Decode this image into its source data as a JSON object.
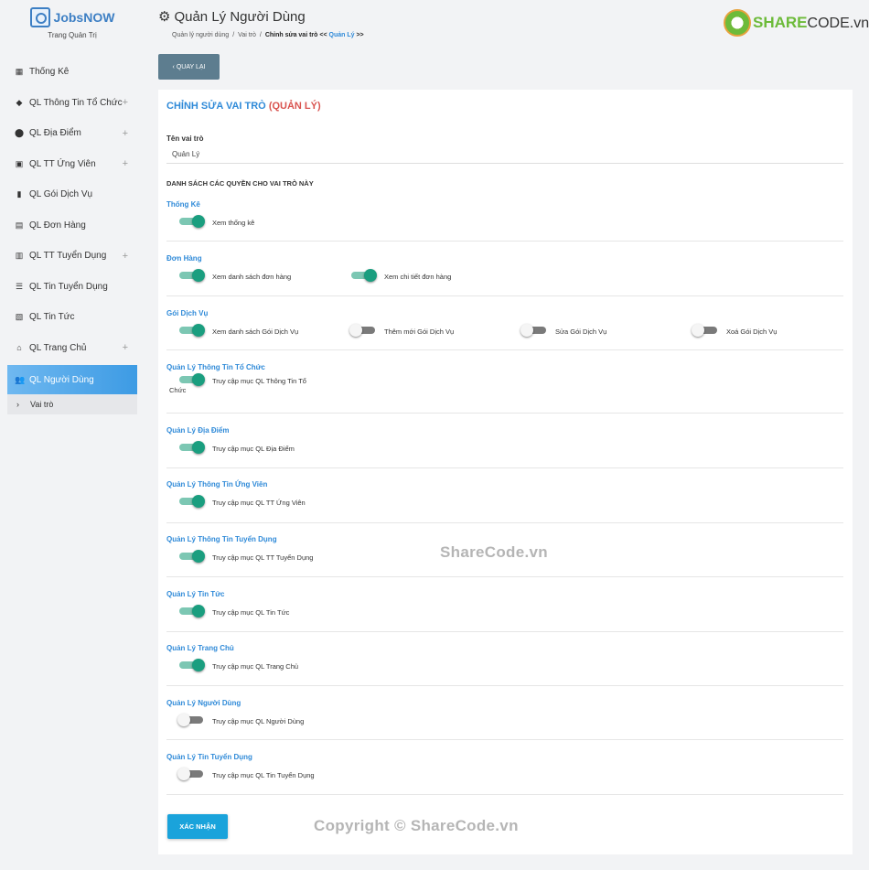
{
  "brand": {
    "name": "JobsNOW",
    "subtitle": "Trang Quản Trị"
  },
  "sidebar": {
    "items": [
      {
        "label": "Thống Kê",
        "icon": "dashboard-icon",
        "glyph": "▦",
        "expandable": false
      },
      {
        "label": "QL Thông Tin Tổ Chức",
        "icon": "layers-icon",
        "glyph": "◆",
        "expandable": true
      },
      {
        "label": "QL Địa Điểm",
        "icon": "map-marker-icon",
        "glyph": "⬤",
        "expandable": true
      },
      {
        "label": "QL TT Ứng Viên",
        "icon": "book-icon",
        "glyph": "▣",
        "expandable": true
      },
      {
        "label": "QL Gói Dịch Vụ",
        "icon": "package-icon",
        "glyph": "▮",
        "expandable": false
      },
      {
        "label": "QL Đơn Hàng",
        "icon": "orders-icon",
        "glyph": "▤",
        "expandable": false
      },
      {
        "label": "QL TT Tuyển Dụng",
        "icon": "clipboard-icon",
        "glyph": "▥",
        "expandable": true
      },
      {
        "label": "QL Tin Tuyển Dụng",
        "icon": "list-icon",
        "glyph": "☰",
        "expandable": false
      },
      {
        "label": "QL Tin Tức",
        "icon": "news-icon",
        "glyph": "▧",
        "expandable": false
      },
      {
        "label": "QL Trang Chủ",
        "icon": "home-icon",
        "glyph": "⌂",
        "expandable": true
      },
      {
        "label": "QL Người Dùng",
        "icon": "users-icon",
        "glyph": "👥",
        "expandable": false,
        "active": true
      }
    ],
    "sub_item": "Vai trò",
    "plus": "+"
  },
  "header": {
    "title": "Quản Lý Người Dùng",
    "breadcrumb": {
      "level1": "Quản lý người dùng",
      "level2": "Vai trò",
      "current_prefix": "Chỉnh sửa vai trò <<",
      "current_role": "Quản Lý",
      "current_suffix": ">>",
      "separator": "/"
    }
  },
  "back_button": "QUAY LẠI",
  "form": {
    "title_prefix": "CHỈNH SỬA VAI TRÒ",
    "title_role": "(QUẢN LÝ)",
    "role_name_label": "Tên vai trò",
    "role_name_value": "Quản Lý",
    "permissions_heading": "DANH SÁCH CÁC QUYỀN CHO VAI TRÒ NÀY",
    "groups": [
      {
        "title": "Thống Kê",
        "permissions": [
          {
            "label": "Xem thống kê",
            "on": true
          }
        ]
      },
      {
        "title": "Đơn Hàng",
        "permissions": [
          {
            "label": "Xem danh sách đơn hàng",
            "on": true
          },
          {
            "label": "Xem chi tiết đơn hàng",
            "on": true
          }
        ]
      },
      {
        "title": "Gói Dịch Vụ",
        "permissions": [
          {
            "label": "Xem danh sách Gói Dịch Vụ",
            "on": true
          },
          {
            "label": "Thêm mới Gói Dịch Vụ",
            "on": false
          },
          {
            "label": "Sửa Gói Dịch Vụ",
            "on": false
          },
          {
            "label": "Xoá Gói Dịch Vụ",
            "on": false
          }
        ]
      },
      {
        "title": "Quản Lý Thông Tin Tổ Chức",
        "permissions": [
          {
            "label": "Truy cập mục QL Thông Tin Tổ",
            "label_wrap": "Chức",
            "on": true
          }
        ]
      },
      {
        "title": "Quản Lý Địa Điểm",
        "permissions": [
          {
            "label": "Truy cập mục QL Địa Điểm",
            "on": true
          }
        ]
      },
      {
        "title": "Quản Lý Thông Tin Ứng Viên",
        "permissions": [
          {
            "label": "Truy cập mục QL TT Ứng Viên",
            "on": true
          }
        ]
      },
      {
        "title": "Quản Lý Thông Tin Tuyển Dụng",
        "permissions": [
          {
            "label": "Truy cập mục QL TT Tuyển Dụng",
            "on": true
          }
        ]
      },
      {
        "title": "Quản Lý Tin Tức",
        "permissions": [
          {
            "label": "Truy cập mục QL Tin Tức",
            "on": true
          }
        ]
      },
      {
        "title": "Quản Lý Trang Chủ",
        "permissions": [
          {
            "label": "Truy cập mục QL Trang Chủ",
            "on": true
          }
        ]
      },
      {
        "title": "Quản Lý Người Dùng",
        "permissions": [
          {
            "label": "Truy cập mục QL Người Dùng",
            "on": false
          }
        ]
      },
      {
        "title": "Quản Lý Tin Tuyển Dụng",
        "permissions": [
          {
            "label": "Truy cập mục QL Tin Tuyển Dụng",
            "on": false
          }
        ]
      }
    ],
    "submit_label": "XÁC NHẬN"
  },
  "logo_text": {
    "brand_highlight": "SHARE",
    "brand_rest": "CODE.vn"
  },
  "watermarks": {
    "center": "ShareCode.vn",
    "bottom": "Copyright © ShareCode.vn"
  },
  "colors": {
    "accent": "#2f8ad8",
    "role_red": "#d9534f",
    "toggle_on": "#1a9e7f",
    "active_nav": "#3d9be4",
    "submit": "#1aa3db"
  }
}
